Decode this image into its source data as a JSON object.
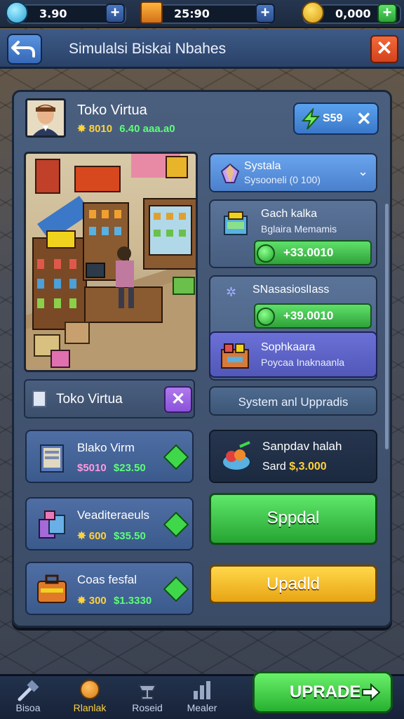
{
  "resources": {
    "coins": "3.90",
    "crates": "25:90",
    "gold": "0,000"
  },
  "title": "Simulalsi Biskai Nbahes",
  "shop": {
    "name": "Toko Virtua",
    "price_gold": "8010",
    "price_green": "6.40 aaa.a0",
    "energy": "S59"
  },
  "right_cards": {
    "dropdown": {
      "title": "Systala",
      "sub": "Sysooneli (0 100)"
    },
    "card1": {
      "title": "Gach kalka",
      "sub": "Bglaira Memamis",
      "value": "+33.0010"
    },
    "card2": {
      "title": "SNasasioslIass",
      "value": "+39.0010"
    },
    "card3": {
      "title": "Sophkaara",
      "sub": "Poycaa Inaknaanla"
    },
    "upgrade_label": "System anl Uppradis"
  },
  "left_section": {
    "label": "Toko Virtua"
  },
  "tiles": [
    {
      "name": "Blako Virm",
      "price_a": "$5010",
      "price_b": "$23.50"
    },
    {
      "name": "Veaditeraeuls",
      "price_a": "600",
      "price_b": "$35.50"
    },
    {
      "name": "Coas fesfal",
      "price_a": "300",
      "price_b": "$1.3330"
    }
  ],
  "promo_card": {
    "title": "Sanpdav halah",
    "sub_label": "Sard",
    "sub_value": "$,3.000"
  },
  "buttons": {
    "green": "Sppdal",
    "yellow": "Upadld",
    "upgrade": "UPRADE"
  },
  "nav": [
    {
      "label": "Bisoa"
    },
    {
      "label": "Rlanlak"
    },
    {
      "label": "Roseid"
    },
    {
      "label": "Mealer"
    }
  ],
  "colors": {
    "gold": "#ffd23c",
    "green_text": "#5cff78",
    "accent_blue": "#5aa2ee"
  }
}
